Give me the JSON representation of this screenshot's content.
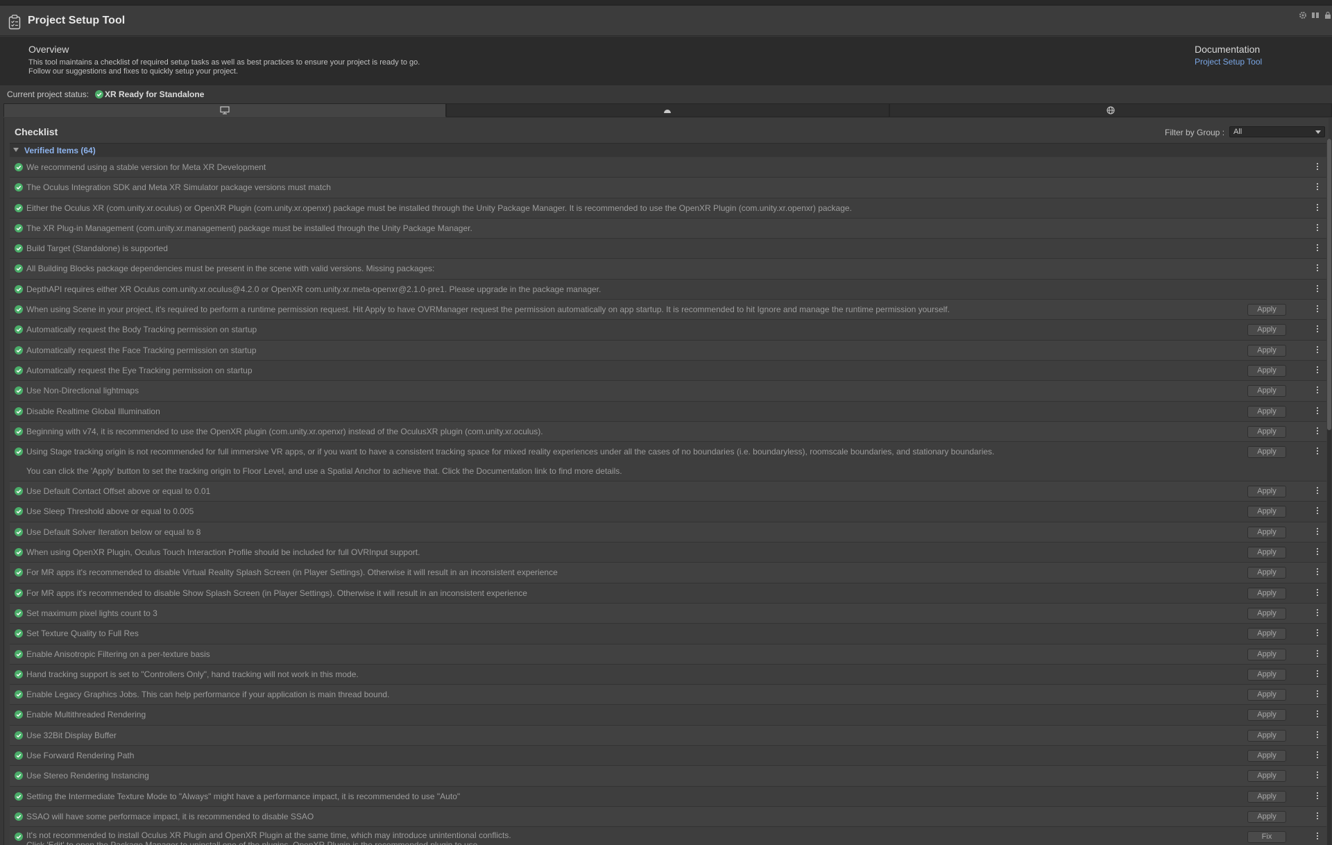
{
  "window": {
    "title": "Project Setup Tool",
    "controls": [
      "settings-icon",
      "layout-icon",
      "lock-icon"
    ]
  },
  "overview": {
    "title": "Overview",
    "description_line1": "This tool maintains a checklist of required setup tasks as well as best practices to ensure your project is ready to go.",
    "description_line2": "Follow our suggestions and fixes to quickly setup your project.",
    "documentation_title": "Documentation",
    "documentation_link": "Project Setup Tool"
  },
  "status": {
    "label": "Current project status:",
    "value": "XR Ready for Standalone",
    "color": "#4cae6a"
  },
  "tabs": [
    {
      "icon": "monitor-icon",
      "active": true
    },
    {
      "icon": "android-icon",
      "active": false
    },
    {
      "icon": "globe-icon",
      "active": false
    }
  ],
  "checklist": {
    "title": "Checklist",
    "filter_label": "Filter by Group :",
    "filter_value": "All",
    "group_title": "Verified Items (64)",
    "items": [
      {
        "text": "We recommend using a stable version for Meta XR Development",
        "action": ""
      },
      {
        "text": "The Oculus Integration SDK and Meta XR Simulator package versions must match",
        "action": ""
      },
      {
        "text": "Either the Oculus XR (com.unity.xr.oculus) or OpenXR Plugin (com.unity.xr.openxr) package must be installed through the Unity Package Manager. It is recommended to use the OpenXR Plugin (com.unity.xr.openxr) package.",
        "action": ""
      },
      {
        "text": "The XR Plug-in Management (com.unity.xr.management) package must be installed through the Unity Package Manager.",
        "action": ""
      },
      {
        "text": "Build Target (Standalone) is supported",
        "action": ""
      },
      {
        "text": "All Building Blocks package dependencies must be present in the scene with valid versions. Missing packages:",
        "action": ""
      },
      {
        "text": "DepthAPI requires either XR Oculus com.unity.xr.oculus@4.2.0 or OpenXR com.unity.xr.meta-openxr@2.1.0-pre1. Please upgrade in the package manager.",
        "action": ""
      },
      {
        "text": "When using Scene in your project, it's required to perform a runtime permission request. Hit Apply to have OVRManager request the permission automatically on app startup. It is recommended to hit Ignore and manage the runtime permission yourself.",
        "action": "Apply"
      },
      {
        "text": "Automatically request the Body Tracking permission on startup",
        "action": "Apply"
      },
      {
        "text": "Automatically request the Face Tracking permission on startup",
        "action": "Apply"
      },
      {
        "text": "Automatically request the Eye Tracking permission on startup",
        "action": "Apply"
      },
      {
        "text": "Use Non-Directional lightmaps",
        "action": "Apply"
      },
      {
        "text": "Disable Realtime Global Illumination",
        "action": "Apply"
      },
      {
        "text": "Beginning with v74, it is recommended to use the OpenXR plugin (com.unity.xr.openxr) instead of the OculusXR plugin (com.unity.xr.oculus).",
        "action": "Apply"
      },
      {
        "text": "Using Stage tracking origin is not recommended for full immersive VR apps, or if you want to have a consistent tracking space for mixed reality experiences under all the cases of no boundaries (i.e. boundaryless), roomscale boundaries, and stationary boundaries.",
        "text2": "You can click the 'Apply' button to set the tracking origin to Floor Level, and use a Spatial Anchor to achieve that. Click the Documentation link to find more details.",
        "action": "Apply"
      },
      {
        "text": "Use Default Contact Offset above or equal to 0.01",
        "action": "Apply"
      },
      {
        "text": "Use Sleep Threshold above or equal to 0.005",
        "action": "Apply"
      },
      {
        "text": "Use Default Solver Iteration below or equal to 8",
        "action": "Apply"
      },
      {
        "text": "When using OpenXR Plugin, Oculus Touch Interaction Profile should be included for full OVRInput support.",
        "action": "Apply"
      },
      {
        "text": "For MR apps it's recommended to disable Virtual Reality Splash Screen (in Player Settings). Otherwise it will result in an inconsistent experience",
        "action": "Apply"
      },
      {
        "text": "For MR apps it's recommended to disable Show Splash Screen (in Player Settings). Otherwise it will result in an inconsistent experience",
        "action": "Apply"
      },
      {
        "text": "Set maximum pixel lights count to 3",
        "action": "Apply"
      },
      {
        "text": "Set Texture Quality to Full Res",
        "action": "Apply"
      },
      {
        "text": "Enable Anisotropic Filtering on a per-texture basis",
        "action": "Apply"
      },
      {
        "text": "Hand tracking support is set to \"Controllers Only\", hand tracking will not work in this mode.",
        "action": "Apply"
      },
      {
        "text": "Enable Legacy Graphics Jobs. This can help performance if your application is main thread bound.",
        "action": "Apply"
      },
      {
        "text": "Enable Multithreaded Rendering",
        "action": "Apply"
      },
      {
        "text": "Use 32Bit Display Buffer",
        "action": "Apply"
      },
      {
        "text": "Use Forward Rendering Path",
        "action": "Apply"
      },
      {
        "text": "Use Stereo Rendering Instancing",
        "action": "Apply"
      },
      {
        "text": "Setting the Intermediate Texture Mode to \"Always\" might have a performance impact, it is recommended to use \"Auto\"",
        "action": "Apply"
      },
      {
        "text": "SSAO will have some performace impact, it is recommended to disable SSAO",
        "action": "Apply"
      },
      {
        "text": "It's not recommended to install Oculus XR Plugin and OpenXR Plugin at the same time, which may introduce unintentional conflicts.",
        "text2": "Click 'Edit' to open the Package Manager to uninstall one of the plugins. OpenXR Plugin is the recommended plugin to use.",
        "action": "Fix"
      }
    ]
  }
}
